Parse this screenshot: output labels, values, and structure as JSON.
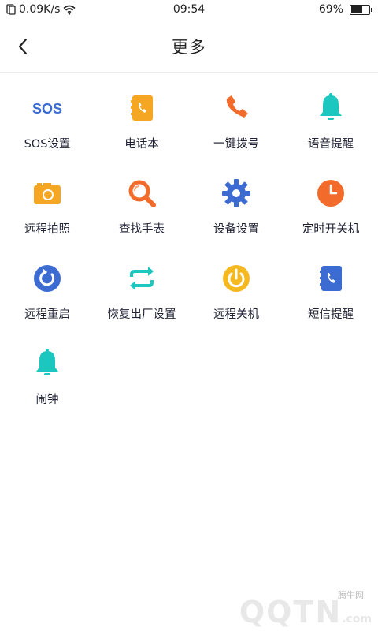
{
  "status_bar": {
    "network_speed": "0.09K/s",
    "time": "09:54",
    "battery_percent": "69%",
    "battery_level": 0.69
  },
  "header": {
    "title": "更多"
  },
  "grid": [
    {
      "name": "sos-settings",
      "label": "SOS设置",
      "icon": "sos-text-icon",
      "icon_text": "SOS",
      "color": "#3c6bd1"
    },
    {
      "name": "phonebook",
      "label": "电话本",
      "icon": "phonebook-icon",
      "color": "#f5a623"
    },
    {
      "name": "one-touch-dial",
      "label": "一键拨号",
      "icon": "phone-icon",
      "color": "#f26b2b"
    },
    {
      "name": "voice-reminder",
      "label": "语音提醒",
      "icon": "bell-icon",
      "color": "#1cc7c0"
    },
    {
      "name": "remote-photo",
      "label": "远程拍照",
      "icon": "camera-icon",
      "color": "#f5a623"
    },
    {
      "name": "find-watch",
      "label": "查找手表",
      "icon": "search-icon",
      "color": "#f26b2b"
    },
    {
      "name": "device-settings",
      "label": "设备设置",
      "icon": "gear-icon",
      "color": "#3c6bd1"
    },
    {
      "name": "scheduled-power",
      "label": "定时开关机",
      "icon": "clock-icon",
      "color": "#f26b2b"
    },
    {
      "name": "remote-restart",
      "label": "远程重启",
      "icon": "restart-icon",
      "color": "#3c6bd1"
    },
    {
      "name": "factory-reset",
      "label": "恢复出厂设置",
      "icon": "reset-arrows-icon",
      "color": "#1cc7c0"
    },
    {
      "name": "remote-shutdown",
      "label": "远程关机",
      "icon": "power-icon",
      "color": "#f5b81f"
    },
    {
      "name": "sms-reminder",
      "label": "短信提醒",
      "icon": "sms-phonebook-icon",
      "color": "#3c6bd1"
    },
    {
      "name": "alarm-clock",
      "label": "闹钟",
      "icon": "bell-icon",
      "color": "#1cc7c0"
    }
  ],
  "watermark": {
    "small_text": "腾牛网",
    "brand": "QQTN",
    "suffix": ".com"
  }
}
